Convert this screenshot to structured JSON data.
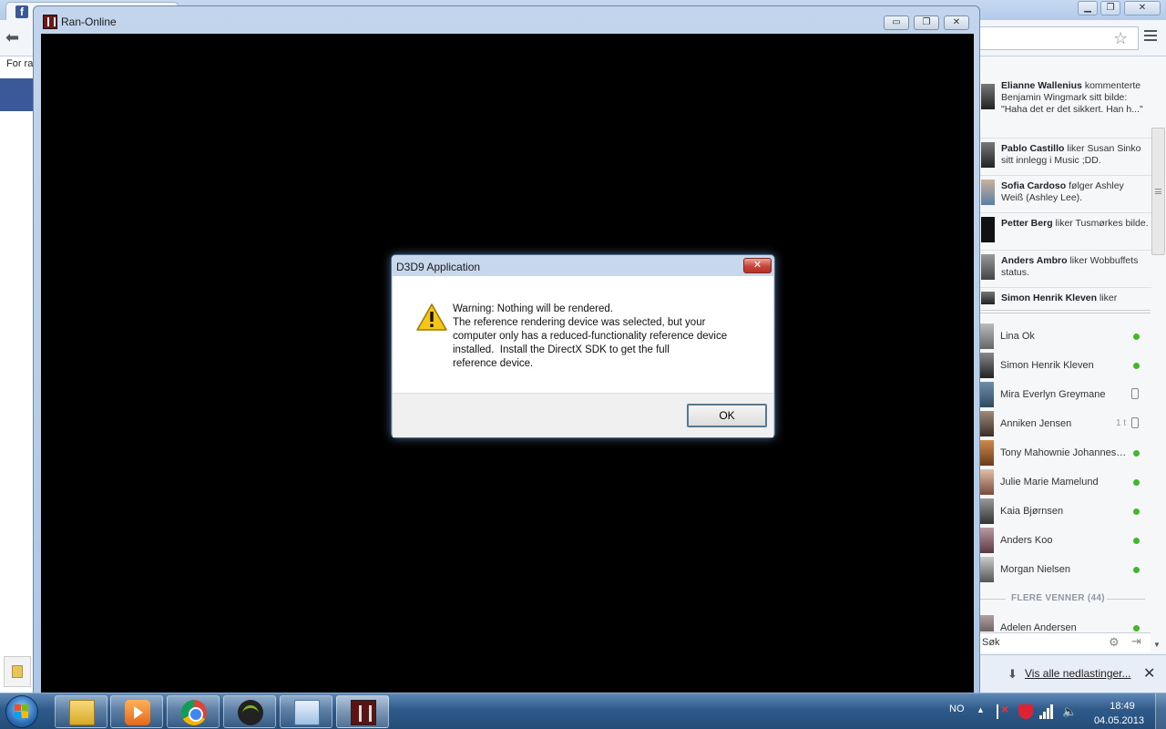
{
  "chrome": {
    "tab_icon": "facebook-icon",
    "bookmark_label": "For ra",
    "sidebar": {
      "ticker": [
        {
          "name": "Elianne Wallenius",
          "text": "kommenterte Benjamin Wingmark sitt bilde: \"Haha det er det sikkert. Han h...\""
        },
        {
          "name": "Pablo Castillo",
          "text": "liker Susan Sinko sitt innlegg i Music ;DD."
        },
        {
          "name": "Sofia Cardoso",
          "text": "følger Ashley Weiß (Ashley Lee)."
        },
        {
          "name": "Petter Berg",
          "text": "liker Tusmørkes bilde."
        },
        {
          "name": "Anders Ambro",
          "text": "liker Wobbuffets status."
        },
        {
          "name": "Simon Henrik Kleven",
          "text": "liker"
        }
      ],
      "friends": [
        {
          "name": "Lina Ok",
          "status": "online"
        },
        {
          "name": "Simon Henrik Kleven",
          "status": "online"
        },
        {
          "name": "Mira Everlyn Greymane",
          "status": "mobile"
        },
        {
          "name": "Anniken Jensen",
          "status": "mobile",
          "time": "1 t"
        },
        {
          "name": "Tony Mahownie Johannessen",
          "status": "online"
        },
        {
          "name": "Julie Marie Mamelund",
          "status": "online"
        },
        {
          "name": "Kaia Bjørnsen",
          "status": "online"
        },
        {
          "name": "Anders Koo",
          "status": "online"
        },
        {
          "name": "Morgan Nielsen",
          "status": "online"
        }
      ],
      "more_friends_label": "FLERE VENNER (44)",
      "more_friends": [
        {
          "name": "Adelen Andersen",
          "status": "online"
        }
      ],
      "search_placeholder": "Søk"
    },
    "downloads_link": "Vis alle nedlastinger..."
  },
  "game_window": {
    "title": "Ran-Online",
    "minimize": "▭",
    "restore": "❐",
    "close": "✕"
  },
  "dialog": {
    "title": "D3D9 Application",
    "close": "✕",
    "icon": "warning-icon",
    "message_heading": "Warning: Nothing will be rendered.",
    "message_body": "The reference rendering device was selected, but your\ncomputer only has a reduced-functionality reference device\ninstalled.  Install the DirectX SDK to get the full\nreference device.",
    "ok_label": "OK"
  },
  "taskbar": {
    "apps": [
      "windows-explorer",
      "media-center",
      "google-chrome",
      "spotify",
      "control-panel",
      "ran-online"
    ],
    "language": "NO",
    "time": "18:49",
    "date": "04.05.2013"
  },
  "colors": {
    "online": "#42b72a",
    "facebook_blue": "#3b5998",
    "dialog_close_red": "#c7453a"
  }
}
